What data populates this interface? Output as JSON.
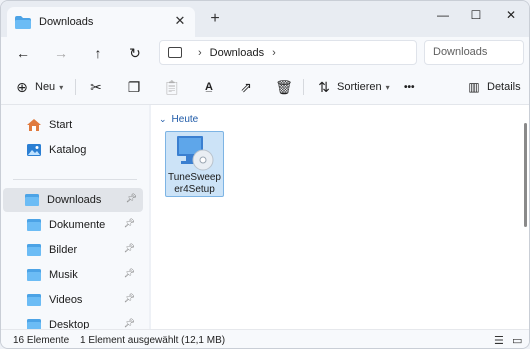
{
  "tab": {
    "title": "Downloads",
    "close": "✕",
    "new_tab": "+"
  },
  "window_controls": {
    "minimize": "—",
    "maximize": "☐",
    "close": "✕"
  },
  "nav": {
    "back": "←",
    "forward": "→",
    "up": "↑",
    "refresh": "↻"
  },
  "address": {
    "crumb": "Downloads",
    "chevron": "›",
    "search_placeholder": "Downloads"
  },
  "toolbar": {
    "new_label": "Neu",
    "sort_label": "Sortieren",
    "more": "•••",
    "details_label": "Details"
  },
  "sidebar": {
    "items": [
      {
        "label": "Start",
        "icon": "home-icon"
      },
      {
        "label": "Katalog",
        "icon": "gallery-icon"
      },
      {
        "label": "Downloads",
        "icon": "downloads-folder-icon",
        "pinned": true,
        "selected": true
      },
      {
        "label": "Dokumente",
        "icon": "documents-folder-icon",
        "pinned": true
      },
      {
        "label": "Bilder",
        "icon": "pictures-folder-icon",
        "pinned": true
      },
      {
        "label": "Musik",
        "icon": "music-folder-icon",
        "pinned": true
      },
      {
        "label": "Videos",
        "icon": "videos-folder-icon",
        "pinned": true
      },
      {
        "label": "Desktop",
        "icon": "desktop-folder-icon",
        "pinned": true
      }
    ]
  },
  "content": {
    "group_label": "Heute",
    "files": [
      {
        "name": "TuneSweeper4Setup",
        "icon": "installer-icon",
        "selected": true
      }
    ]
  },
  "status": {
    "count": "16 Elemente",
    "selection": "1 Element ausgewählt (12,1 MB)"
  },
  "colors": {
    "accent": "#1e5aa8",
    "selection": "#cce3f7",
    "folder": "#4ca3e6"
  }
}
